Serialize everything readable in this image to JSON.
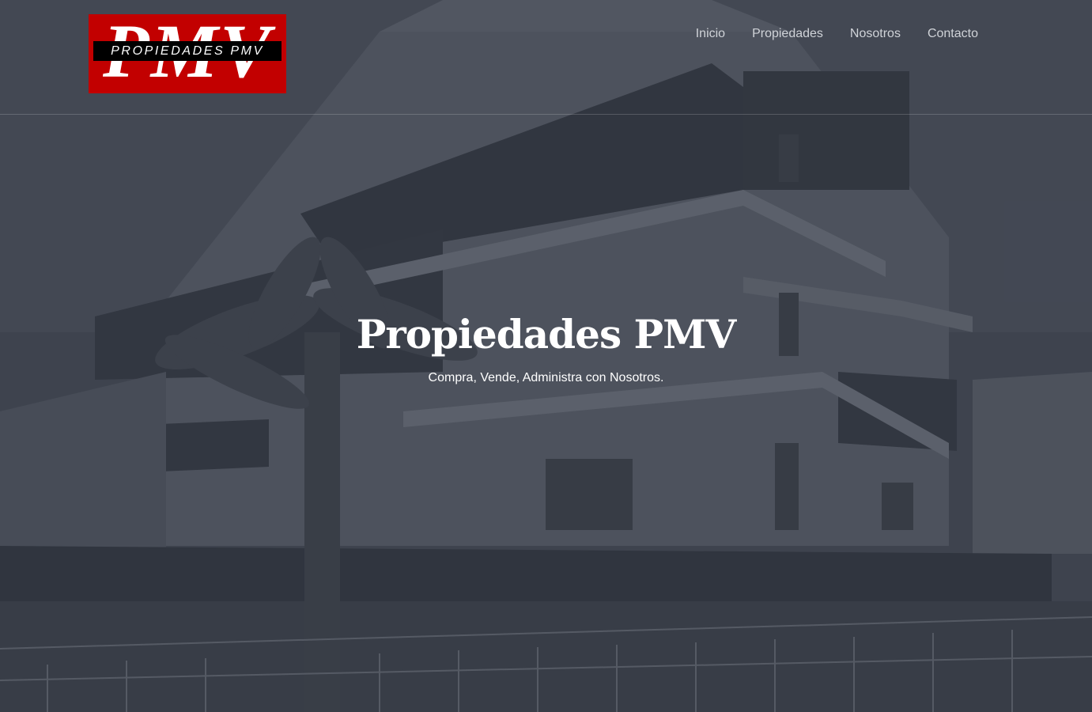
{
  "logo": {
    "letters": "PMV",
    "band_text": "PROPIEDADES PMV",
    "bg_color": "#c20000"
  },
  "nav": {
    "items": [
      {
        "label": "Inicio"
      },
      {
        "label": "Propiedades"
      },
      {
        "label": "Nosotros"
      },
      {
        "label": "Contacto"
      }
    ]
  },
  "hero": {
    "title": "Propiedades PMV",
    "subtitle": "Compra, Vende, Administra con Nosotros."
  }
}
